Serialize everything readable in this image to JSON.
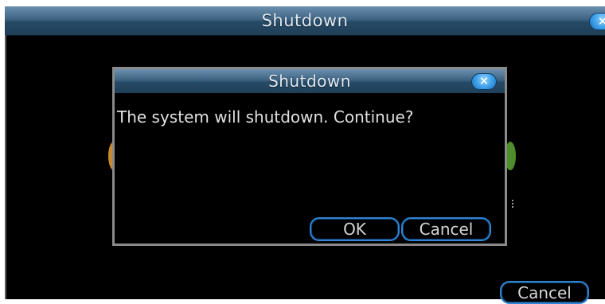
{
  "outer_window": {
    "title": "Shutdown",
    "close_symbol": "✕",
    "cancel_label": "Cancel"
  },
  "dialog": {
    "title": "Shutdown",
    "close_symbol": "✕",
    "message": "The system will shutdown. Continue?",
    "ok_label": "OK",
    "cancel_label": "Cancel"
  },
  "colors": {
    "titlebar": "#3f6482",
    "button_border": "#2f84d4",
    "close_button": "#3b9ee8",
    "background": "#000000"
  }
}
